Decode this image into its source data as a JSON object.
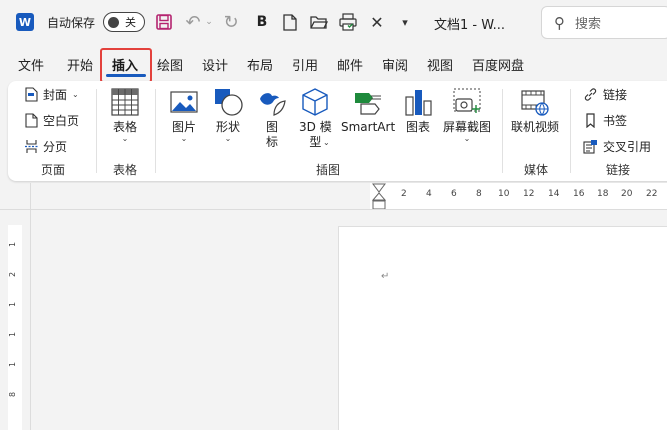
{
  "app": {
    "logo": "W",
    "doc_title": "文档1 - W..."
  },
  "quick_access": {
    "autosave_label": "自动保存",
    "autosave_state": "关",
    "bold": "B"
  },
  "search": {
    "placeholder": "搜索"
  },
  "tabs": [
    {
      "label": "文件"
    },
    {
      "label": "开始"
    },
    {
      "label": "插入",
      "active": true
    },
    {
      "label": "绘图"
    },
    {
      "label": "设计"
    },
    {
      "label": "布局"
    },
    {
      "label": "引用"
    },
    {
      "label": "邮件"
    },
    {
      "label": "审阅"
    },
    {
      "label": "视图"
    },
    {
      "label": "百度网盘"
    }
  ],
  "ribbon": {
    "pages": {
      "cover": "封面",
      "blank": "空白页",
      "break": "分页",
      "group": "页面"
    },
    "tables": {
      "table": "表格",
      "group": "表格"
    },
    "illustrations": {
      "pictures": "图片",
      "shapes": "形状",
      "icons_1": "图",
      "icons_2": "标",
      "model_1": "3D 模",
      "model_2": "型",
      "smartart": "SmartArt",
      "chart": "图表",
      "screenshot": "屏幕截图",
      "group": "插图"
    },
    "media": {
      "online_video": "联机视频",
      "group": "媒体"
    },
    "links": {
      "link": "链接",
      "bookmark": "书签",
      "crossref": "交叉引用",
      "group": "链接"
    }
  },
  "ruler": {
    "top": [
      "2",
      "4",
      "6",
      "8",
      "10",
      "12",
      "14",
      "16",
      "18",
      "20",
      "22"
    ],
    "left": [
      "1",
      "2",
      "1",
      "1",
      "1",
      "8"
    ]
  },
  "document": {
    "paragraph_mark": "↵"
  },
  "colors": {
    "accent": "#185abd",
    "highlight": "#e3413c"
  }
}
